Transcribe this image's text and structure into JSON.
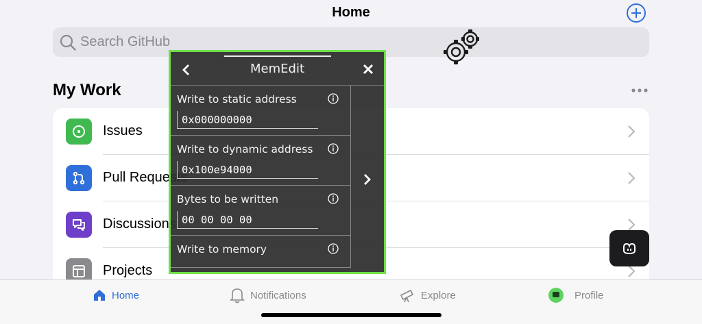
{
  "header": {
    "title": "Home"
  },
  "search": {
    "placeholder": "Search GitHub"
  },
  "my_work": {
    "title": "My Work",
    "items": [
      {
        "label": "Issues",
        "color": "#3fb950",
        "icon": "issue-opened-icon"
      },
      {
        "label": "Pull Requests",
        "color": "#2f6fd9",
        "icon": "git-pull-request-icon"
      },
      {
        "label": "Discussions",
        "color": "#6e40c9",
        "icon": "comment-discussion-icon"
      },
      {
        "label": "Projects",
        "color": "#8a8a8e",
        "icon": "table-icon"
      }
    ]
  },
  "tabbar": {
    "tabs": [
      {
        "label": "Home",
        "icon": "home-icon",
        "active": true
      },
      {
        "label": "Notifications",
        "icon": "bell-icon",
        "active": false
      },
      {
        "label": "Explore",
        "icon": "telescope-icon",
        "active": false
      },
      {
        "label": "Profile",
        "icon": "avatar",
        "active": false
      }
    ]
  },
  "memedit": {
    "title": "MemEdit",
    "rows": [
      {
        "label": "Write to static address",
        "value": "0x000000000"
      },
      {
        "label": "Write to dynamic address",
        "value": "0x100e94000"
      },
      {
        "label": "Bytes to be written",
        "value": "00 00 00 00"
      },
      {
        "label": "Write to memory"
      }
    ]
  },
  "colors": {
    "accent": "#2f6fd9",
    "overlay_border": "#6fe04a"
  }
}
